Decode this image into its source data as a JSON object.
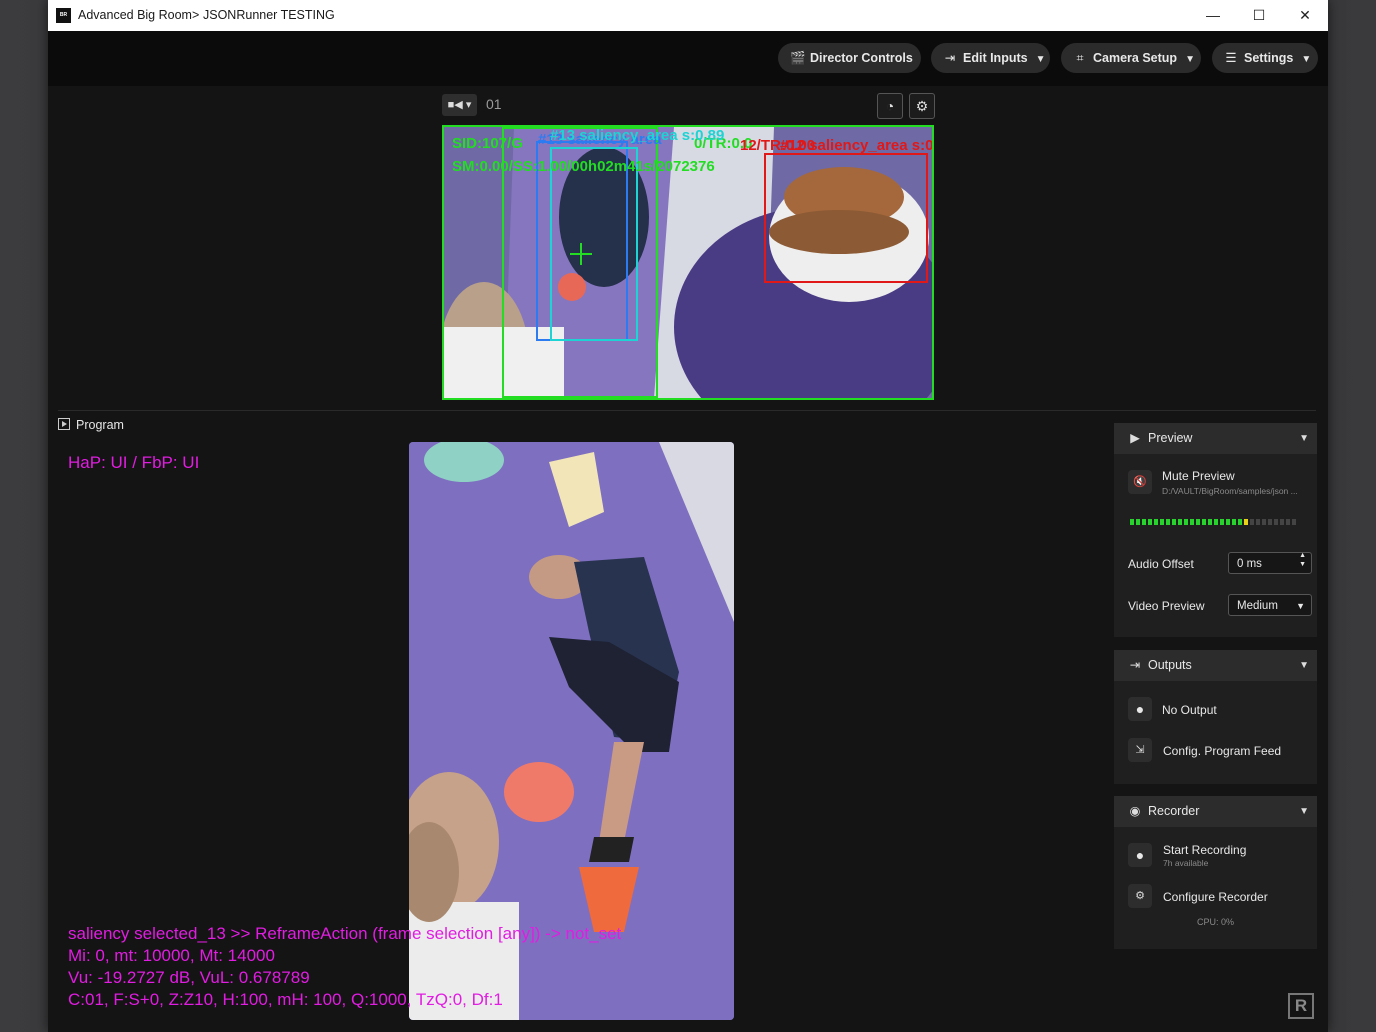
{
  "window": {
    "title": "Advanced Big Room",
    "separator": ">",
    "subtitle": "JSONRunner TESTING",
    "logo_text": "BR",
    "controls": {
      "minimize": "—",
      "maximize": "☐",
      "close": "✕"
    }
  },
  "toolbar": {
    "buttons": [
      {
        "label": "Director Controls",
        "icon": "clapperboard-icon"
      },
      {
        "label": "Edit Inputs",
        "icon": "input-icon"
      },
      {
        "label": "Camera Setup",
        "icon": "frame-icon"
      },
      {
        "label": "Settings",
        "icon": "menu-icon"
      }
    ]
  },
  "camera": {
    "number": "01",
    "overlay": {
      "line1": "SID:107/G",
      "line1_tail": "0/TR:0.0",
      "line2": "SM:0.00/SS:1.00/00h02m41s/2072376",
      "label_cyan": "#13 saliency_area s:0.89",
      "label_blue": "#13 saliency area",
      "label_red": "#12 saliency_area s:0",
      "label_red_prefix": "12/TR:0.00"
    }
  },
  "program": {
    "label": "Program",
    "overlay_top": "HaP: UI / FbP: UI",
    "overlay_bottom": [
      "saliency selected_13 >> ReframeAction (frame selection [any]) -> not_set",
      "Mi: 0, mt: 10000, Mt: 14000",
      "Vu: -19.2727 dB, VuL: 0.678789",
      "C:01, F:S+0, Z:Z10, H:100, mH: 100, Q:1000, TzQ:0, Df:1"
    ]
  },
  "preview_panel": {
    "title": "Preview",
    "mute_label": "Mute Preview",
    "path": "D:/VAULT/BigRoom/samples/json ...",
    "meter_level": 0.72,
    "audio_offset_label": "Audio Offset",
    "audio_offset_value": "0 ms",
    "video_preview_label": "Video Preview",
    "video_preview_value": "Medium"
  },
  "outputs_panel": {
    "title": "Outputs",
    "no_output": "No Output",
    "config_feed": "Config. Program Feed"
  },
  "recorder_panel": {
    "title": "Recorder",
    "start_recording": "Start Recording",
    "available": "7h available",
    "configure": "Configure Recorder",
    "cpu": "CPU: 0%"
  },
  "colors": {
    "overlay_magenta": "#e21ce2",
    "box_green": "#22dd22",
    "box_red": "#e01818",
    "box_cyan": "#1ed3d3",
    "box_blue": "#2d7bf0"
  },
  "brand_logo": "R"
}
